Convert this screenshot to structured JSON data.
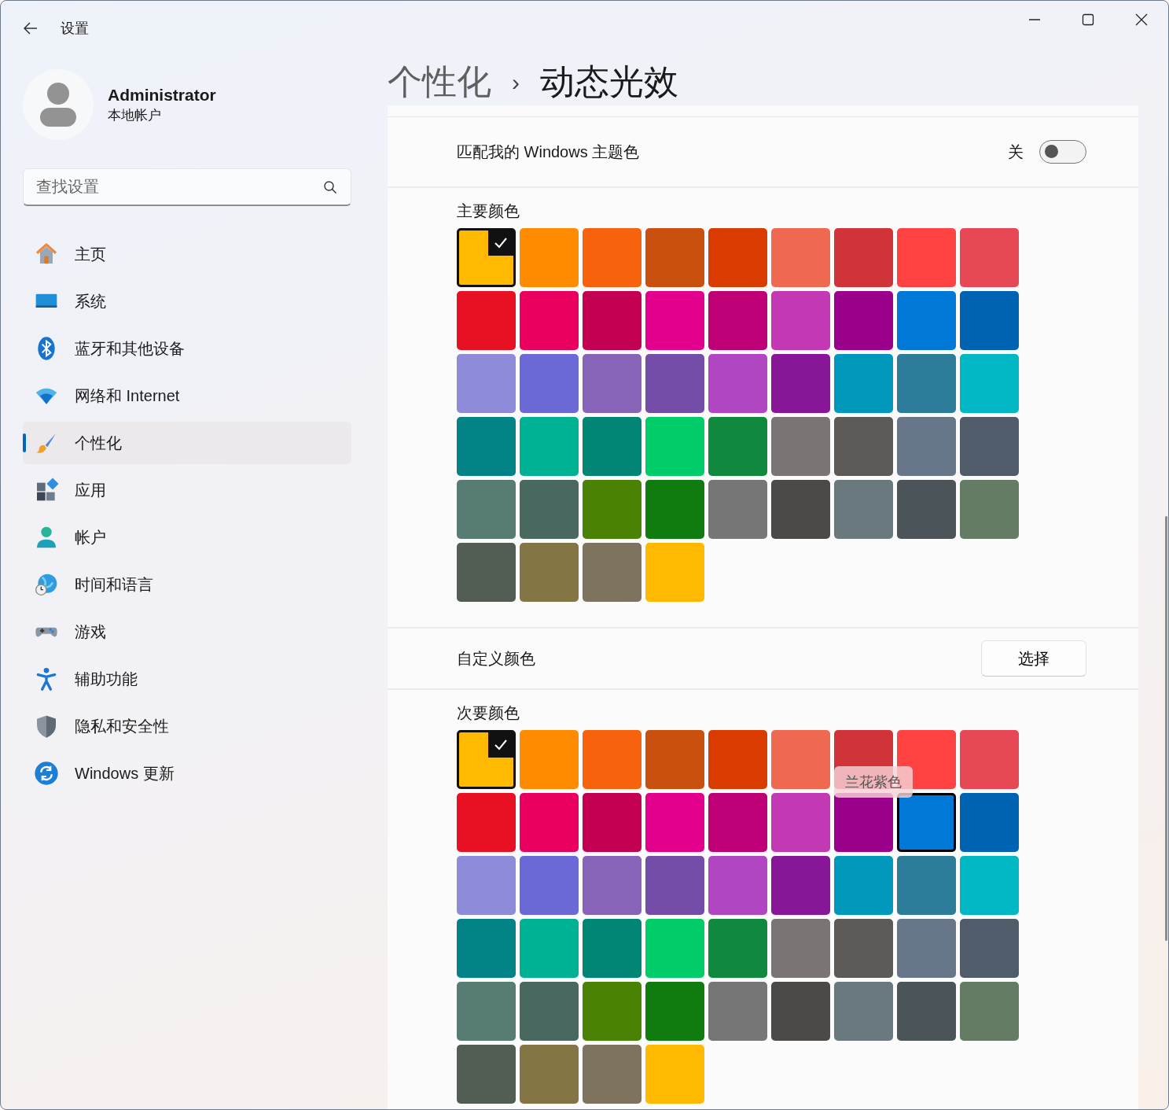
{
  "window": {
    "title": "设置"
  },
  "account": {
    "name": "Administrator",
    "type": "本地帐户"
  },
  "search": {
    "placeholder": "查找设置"
  },
  "sidebar": {
    "items": [
      {
        "kind": "home",
        "label": "主页",
        "selected": false
      },
      {
        "kind": "system",
        "label": "系统",
        "selected": false
      },
      {
        "kind": "bluetooth",
        "label": "蓝牙和其他设备",
        "selected": false
      },
      {
        "kind": "network",
        "label": "网络和 Internet",
        "selected": false
      },
      {
        "kind": "personalization",
        "label": "个性化",
        "selected": true
      },
      {
        "kind": "apps",
        "label": "应用",
        "selected": false
      },
      {
        "kind": "accounts",
        "label": "帐户",
        "selected": false
      },
      {
        "kind": "time",
        "label": "时间和语言",
        "selected": false
      },
      {
        "kind": "gaming",
        "label": "游戏",
        "selected": false
      },
      {
        "kind": "accessibility",
        "label": "辅助功能",
        "selected": false
      },
      {
        "kind": "privacy",
        "label": "隐私和安全性",
        "selected": false
      },
      {
        "kind": "update",
        "label": "Windows 更新",
        "selected": false
      }
    ]
  },
  "breadcrumb": {
    "parent": "个性化",
    "separator": "›",
    "current": "动态光效"
  },
  "match_theme": {
    "label": "匹配我的 Windows 主题色",
    "state_text": "关",
    "on": false
  },
  "primary_colors": {
    "title": "主要颜色",
    "swatches": [
      {
        "color": "#ffb900",
        "selected": true
      },
      {
        "color": "#ff8c00",
        "selected": false
      },
      {
        "color": "#f7630c",
        "selected": false
      },
      {
        "color": "#ca5010",
        "selected": false
      },
      {
        "color": "#da3b01",
        "selected": false
      },
      {
        "color": "#ef6950",
        "selected": false
      },
      {
        "color": "#d13438",
        "selected": false
      },
      {
        "color": "#ff4343",
        "selected": false
      },
      {
        "color": "#e74856",
        "selected": false
      },
      {
        "color": "#e81123",
        "selected": false
      },
      {
        "color": "#ea005e",
        "selected": false
      },
      {
        "color": "#c30052",
        "selected": false
      },
      {
        "color": "#e3008c",
        "selected": false
      },
      {
        "color": "#bf0077",
        "selected": false
      },
      {
        "color": "#c239b3",
        "selected": false
      },
      {
        "color": "#9a0089",
        "selected": false
      },
      {
        "color": "#0078d7",
        "selected": false
      },
      {
        "color": "#0063b1",
        "selected": false
      },
      {
        "color": "#8e8cd8",
        "selected": false
      },
      {
        "color": "#6b69d6",
        "selected": false
      },
      {
        "color": "#8764b8",
        "selected": false
      },
      {
        "color": "#744da9",
        "selected": false
      },
      {
        "color": "#b146c2",
        "selected": false
      },
      {
        "color": "#881798",
        "selected": false
      },
      {
        "color": "#0099bc",
        "selected": false
      },
      {
        "color": "#2d7d9a",
        "selected": false
      },
      {
        "color": "#00b7c3",
        "selected": false
      },
      {
        "color": "#038387",
        "selected": false
      },
      {
        "color": "#00b294",
        "selected": false
      },
      {
        "color": "#018574",
        "selected": false
      },
      {
        "color": "#00cc6a",
        "selected": false
      },
      {
        "color": "#10893e",
        "selected": false
      },
      {
        "color": "#7a7574",
        "selected": false
      },
      {
        "color": "#5d5a58",
        "selected": false
      },
      {
        "color": "#68768a",
        "selected": false
      },
      {
        "color": "#515c6b",
        "selected": false
      },
      {
        "color": "#567c73",
        "selected": false
      },
      {
        "color": "#486860",
        "selected": false
      },
      {
        "color": "#498205",
        "selected": false
      },
      {
        "color": "#107c10",
        "selected": false
      },
      {
        "color": "#767676",
        "selected": false
      },
      {
        "color": "#4c4a48",
        "selected": false
      },
      {
        "color": "#69797e",
        "selected": false
      },
      {
        "color": "#4a5459",
        "selected": false
      },
      {
        "color": "#647c64",
        "selected": false
      },
      {
        "color": "#525e54",
        "selected": false
      },
      {
        "color": "#847545",
        "selected": false
      },
      {
        "color": "#7e735f",
        "selected": false
      },
      {
        "color": "#ffb900",
        "selected": false
      }
    ]
  },
  "custom_color": {
    "label": "自定义颜色",
    "button": "选择"
  },
  "secondary_colors": {
    "title": "次要颜色",
    "tooltip": "兰花紫色",
    "swatches": [
      {
        "color": "#ffb900",
        "selected": true,
        "focused": false
      },
      {
        "color": "#ff8c00",
        "selected": false,
        "focused": false
      },
      {
        "color": "#f7630c",
        "selected": false,
        "focused": false
      },
      {
        "color": "#ca5010",
        "selected": false,
        "focused": false
      },
      {
        "color": "#da3b01",
        "selected": false,
        "focused": false
      },
      {
        "color": "#ef6950",
        "selected": false,
        "focused": false
      },
      {
        "color": "#d13438",
        "selected": false,
        "focused": false
      },
      {
        "color": "#ff4343",
        "selected": false,
        "focused": false
      },
      {
        "color": "#e74856",
        "selected": false,
        "focused": false
      },
      {
        "color": "#e81123",
        "selected": false,
        "focused": false
      },
      {
        "color": "#ea005e",
        "selected": false,
        "focused": false
      },
      {
        "color": "#c30052",
        "selected": false,
        "focused": false
      },
      {
        "color": "#e3008c",
        "selected": false,
        "focused": false
      },
      {
        "color": "#bf0077",
        "selected": false,
        "focused": false
      },
      {
        "color": "#c239b3",
        "selected": false,
        "focused": false
      },
      {
        "color": "#9a0089",
        "selected": false,
        "focused": false
      },
      {
        "color": "#0078d7",
        "selected": false,
        "focused": true
      },
      {
        "color": "#0063b1",
        "selected": false,
        "focused": false
      },
      {
        "color": "#8e8cd8",
        "selected": false,
        "focused": false
      },
      {
        "color": "#6b69d6",
        "selected": false,
        "focused": false
      },
      {
        "color": "#8764b8",
        "selected": false,
        "focused": false
      },
      {
        "color": "#744da9",
        "selected": false,
        "focused": false
      },
      {
        "color": "#b146c2",
        "selected": false,
        "focused": false
      },
      {
        "color": "#881798",
        "selected": false,
        "focused": false
      },
      {
        "color": "#0099bc",
        "selected": false,
        "focused": false
      },
      {
        "color": "#2d7d9a",
        "selected": false,
        "focused": false
      },
      {
        "color": "#00b7c3",
        "selected": false,
        "focused": false
      },
      {
        "color": "#038387",
        "selected": false,
        "focused": false
      },
      {
        "color": "#00b294",
        "selected": false,
        "focused": false
      },
      {
        "color": "#018574",
        "selected": false,
        "focused": false
      },
      {
        "color": "#00cc6a",
        "selected": false,
        "focused": false
      },
      {
        "color": "#10893e",
        "selected": false,
        "focused": false
      },
      {
        "color": "#7a7574",
        "selected": false,
        "focused": false
      },
      {
        "color": "#5d5a58",
        "selected": false,
        "focused": false
      },
      {
        "color": "#68768a",
        "selected": false,
        "focused": false
      },
      {
        "color": "#515c6b",
        "selected": false,
        "focused": false
      },
      {
        "color": "#567c73",
        "selected": false,
        "focused": false
      },
      {
        "color": "#486860",
        "selected": false,
        "focused": false
      },
      {
        "color": "#498205",
        "selected": false,
        "focused": false
      },
      {
        "color": "#107c10",
        "selected": false,
        "focused": false
      },
      {
        "color": "#767676",
        "selected": false,
        "focused": false
      },
      {
        "color": "#4c4a48",
        "selected": false,
        "focused": false
      },
      {
        "color": "#69797e",
        "selected": false,
        "focused": false
      },
      {
        "color": "#4a5459",
        "selected": false,
        "focused": false
      },
      {
        "color": "#647c64",
        "selected": false,
        "focused": false
      },
      {
        "color": "#525e54",
        "selected": false,
        "focused": false
      },
      {
        "color": "#847545",
        "selected": false,
        "focused": false
      },
      {
        "color": "#7e735f",
        "selected": false,
        "focused": false
      },
      {
        "color": "#ffb900",
        "selected": false,
        "focused": false
      }
    ]
  }
}
